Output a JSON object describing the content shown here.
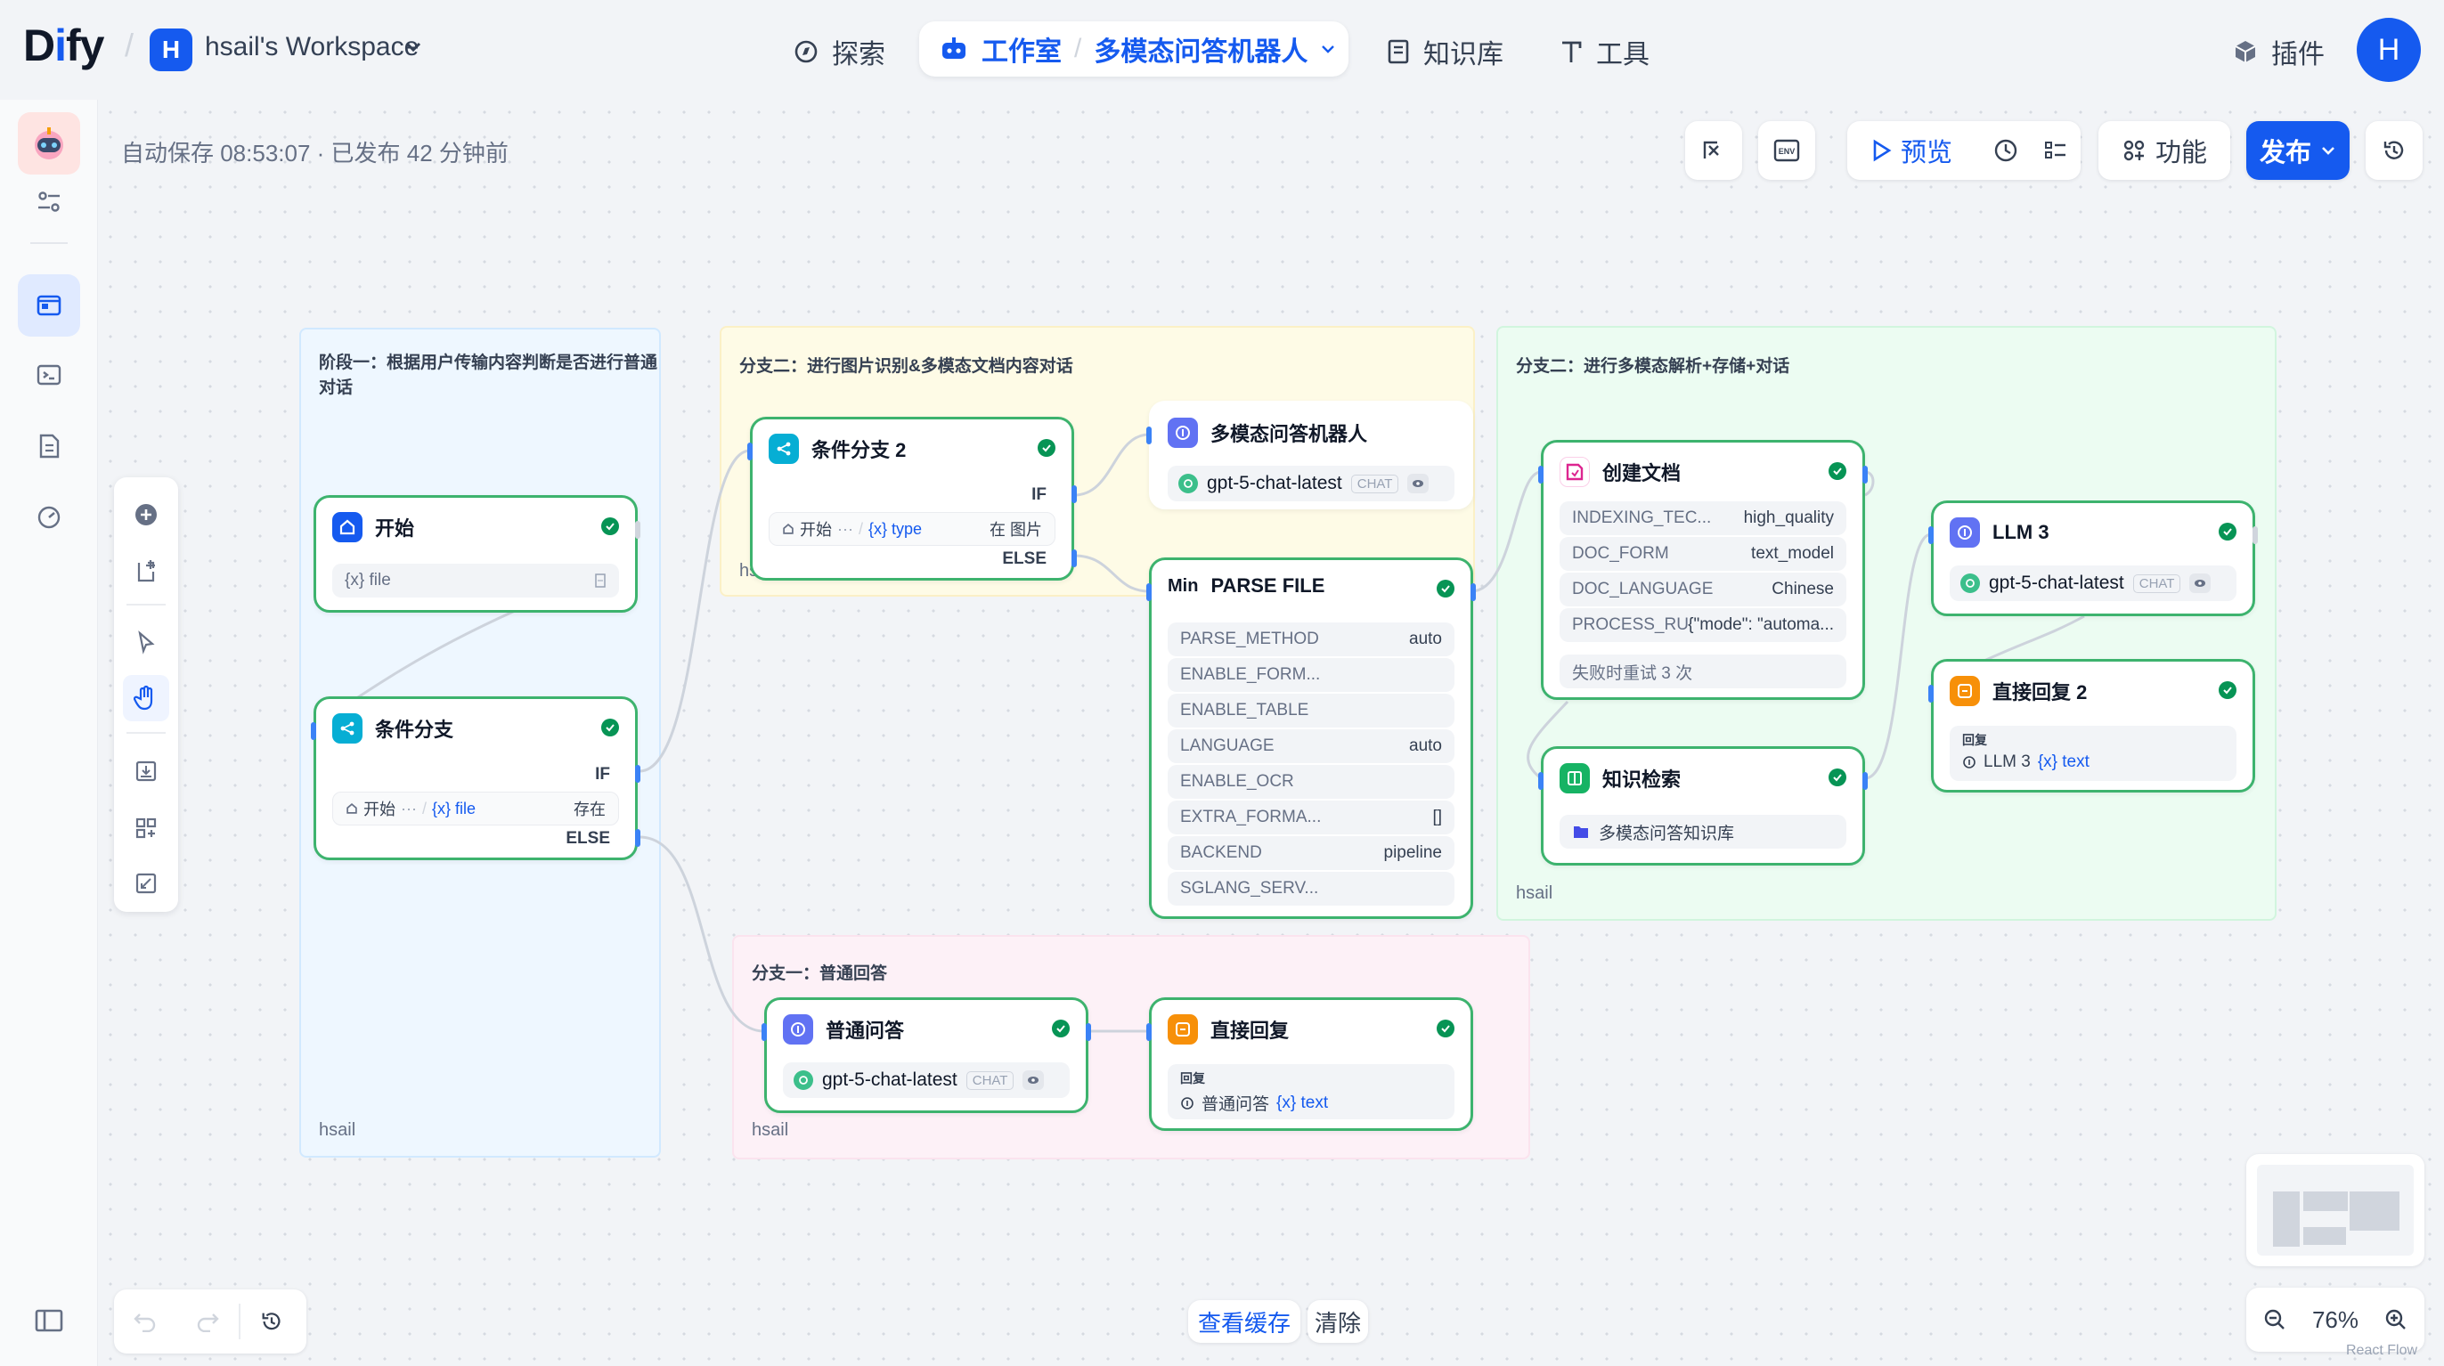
{
  "brand": {
    "logo_text_a": "D",
    "logo_text_b": "i",
    "logo_text_c": "fy"
  },
  "workspace": {
    "avatar": "H",
    "name": "hsail's Workspace"
  },
  "nav": {
    "explore": "探索",
    "studio": "工作室",
    "app_name": "多模态问答机器人",
    "knowledge": "知识库",
    "tools": "工具",
    "plugins": "插件",
    "user_avatar": "H"
  },
  "status": {
    "autosave": "自动保存 08:53:07 · 已发布 42 分钟前"
  },
  "toolbar": {
    "preview": "预览",
    "features": "功能",
    "publish": "发布",
    "env": "ENV"
  },
  "groups": {
    "stage1": {
      "title_l1": "阶段一：根据用户传输内容判断是否进行普通",
      "title_l2": "对话",
      "footer": "hsail"
    },
    "branch2": {
      "title": "分支二：进行图片识别&多模态文档内容对话",
      "footer": "hs"
    },
    "branch2b": {
      "title": "分支二：进行多模态解析+存储+对话",
      "footer": "hsail"
    },
    "branch1": {
      "title": "分支一：普通回答",
      "footer": "hsail"
    }
  },
  "nodes": {
    "start": {
      "title": "开始",
      "var": "{x} file"
    },
    "ifelse1": {
      "title": "条件分支",
      "if": "IF",
      "else": "ELSE",
      "cond_src": "开始",
      "cond_dots": "···",
      "cond_var": "{x} file",
      "cond_op": "存在"
    },
    "ifelse2": {
      "title": "条件分支 2",
      "if": "IF",
      "else": "ELSE",
      "cond_src": "开始",
      "cond_dots": "···",
      "cond_var": "{x} type",
      "cond_op": "在 图片"
    },
    "llm_mm": {
      "title": "多模态问答机器人",
      "model": "gpt-5-chat-latest",
      "badge": "CHAT"
    },
    "parse": {
      "prefix": "Min",
      "title": "PARSE FILE",
      "rows": [
        {
          "k": "PARSE_METHOD",
          "v": "auto"
        },
        {
          "k": "ENABLE_FORM...",
          "v": ""
        },
        {
          "k": "ENABLE_TABLE",
          "v": ""
        },
        {
          "k": "LANGUAGE",
          "v": "auto"
        },
        {
          "k": "ENABLE_OCR",
          "v": ""
        },
        {
          "k": "EXTRA_FORMA...",
          "v": "[]"
        },
        {
          "k": "BACKEND",
          "v": "pipeline"
        },
        {
          "k": "SGLANG_SERV...",
          "v": ""
        }
      ]
    },
    "createdoc": {
      "title": "创建文档",
      "rows": [
        {
          "k": "INDEXING_TEC...",
          "v": "high_quality"
        },
        {
          "k": "DOC_FORM",
          "v": "text_model"
        },
        {
          "k": "DOC_LANGUAGE",
          "v": "Chinese"
        },
        {
          "k": "PROCESS_RULE",
          "v": "{\"mode\": \"automa..."
        }
      ],
      "retry": "失败时重试 3 次"
    },
    "retrieval": {
      "title": "知识检索",
      "kb": "多模态问答知识库"
    },
    "llm3": {
      "title": "LLM 3",
      "model": "gpt-5-chat-latest",
      "badge": "CHAT"
    },
    "answer2": {
      "title": "直接回复 2",
      "label": "回复",
      "src": "LLM 3",
      "var": "{x} text"
    },
    "plain_llm": {
      "title": "普通问答",
      "model": "gpt-5-chat-latest",
      "badge": "CHAT"
    },
    "answer": {
      "title": "直接回复",
      "label": "回复",
      "src": "普通问答",
      "var": "{x} text"
    }
  },
  "bottom": {
    "view_cache": "查看缓存",
    "clear": "清除",
    "zoom": "76%",
    "attribution": "React Flow"
  },
  "colors": {
    "accent": "#155aef",
    "success": "#079455",
    "node_border": "#3db36e",
    "stage1_bg": "#eff8ff",
    "branch2_bg": "#fefbe8",
    "branch2b_bg": "#ecfdf3",
    "branch1_bg": "#fdf2f8"
  }
}
